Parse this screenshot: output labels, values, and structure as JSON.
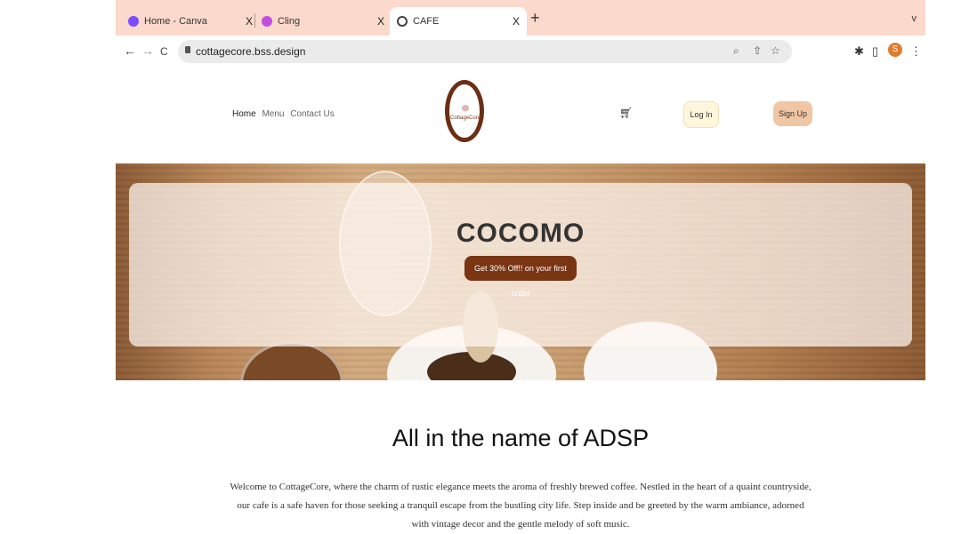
{
  "tabs": [
    {
      "title": "Home - Canva",
      "favicon": "canva-icon",
      "color": "#7b4dff"
    },
    {
      "title": "Cling",
      "favicon": "cling-icon",
      "color": "#c04de0"
    },
    {
      "title": "CAFE",
      "favicon": "globe-icon",
      "color": "#444444"
    }
  ],
  "toolbar": {
    "back": "←",
    "forward": "→",
    "reload": "C",
    "url": "cottagecore.bss.design",
    "profile_initial": "S"
  },
  "site": {
    "nav": [
      "Home",
      "Menu",
      "Contact Us"
    ],
    "logo_text": "CottageCore",
    "login": "Log In",
    "signup": "Sign Up",
    "brand": "COCOMO",
    "promo": "Get 30% Off!! on your first order",
    "headline": "All in the name of ADSP",
    "paragraph": "Welcome to CottageCore, where the charm of rustic elegance meets the aroma of freshly brewed coffee. Nestled in the heart of a quaint countryside, our cafe is a safe haven for those seeking a tranquil escape from the bustling city life. Step inside and be greeted by the warm ambiance, adorned with vintage decor and the gentle melody of soft music."
  },
  "colors": {
    "tabstrip": "#fbd9cc",
    "promo_button": "#7a3512",
    "signup_button": "#f0c6a4",
    "login_button": "#fff6dc"
  }
}
